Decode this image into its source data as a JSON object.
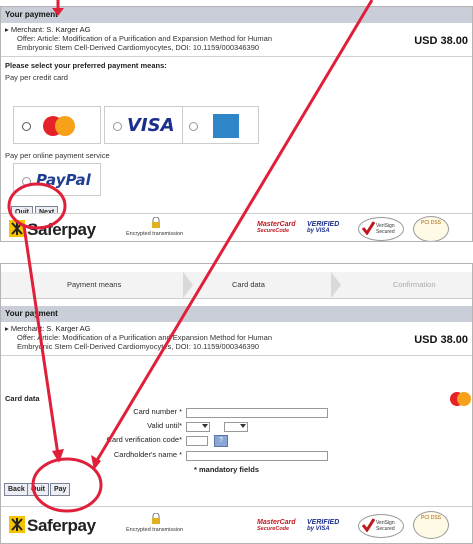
{
  "panel1": {
    "title": "Your payment",
    "merchant": "Merchant: S. Karger AG",
    "offer_line1": "Offer: Article: Modification of a Purification and Expansion Method for Human",
    "offer_line2": "Embryonic Stem Cell-Derived Cardiomyocytes, DOI: 10.1159/000346390",
    "price": "USD 38.00",
    "select_label": "Please select your preferred payment means:",
    "credit_card_label": "Pay per credit card",
    "online_label": "Pay per online payment service",
    "visa": "VISA",
    "paypal": "PayPal",
    "buttons": {
      "quit": "Quit",
      "next": "Next"
    }
  },
  "panel2": {
    "steps": [
      "Payment means",
      "Card data",
      "Confirmation"
    ],
    "title": "Your payment",
    "merchant": "Merchant: S. Karger AG",
    "offer_line1": "Offer: Article: Modification of a Purification and Expansion Method for Human",
    "offer_line2": "Embryonic Stem Cell-Derived Cardiomyocytes, DOI: 10.1159/000346390",
    "price": "USD 38.00",
    "card_data_label": "Card data",
    "fields": {
      "card_number": "Card number *",
      "valid_until": "Valid until*",
      "cvc": "Card verification code*",
      "holder": "Cardholder's name *"
    },
    "help": "?",
    "mandatory": "* mandatory fields",
    "buttons": {
      "back": "Back",
      "quit": "Quit",
      "pay": "Pay"
    }
  },
  "footer": {
    "brand": "Saferpay",
    "encrypted": "Encrypted transmission",
    "mastercard_sc_1": "MasterCard",
    "mastercard_sc_2": "SecureCode",
    "vbv_1": "VERIFIED",
    "vbv_2": "by VISA",
    "verisign_1": "VeriSign",
    "verisign_2": "Secured",
    "pci": "PCI DSS"
  },
  "colors": {
    "annotation": "#e0203a",
    "titlebar": "#c9ced8"
  }
}
